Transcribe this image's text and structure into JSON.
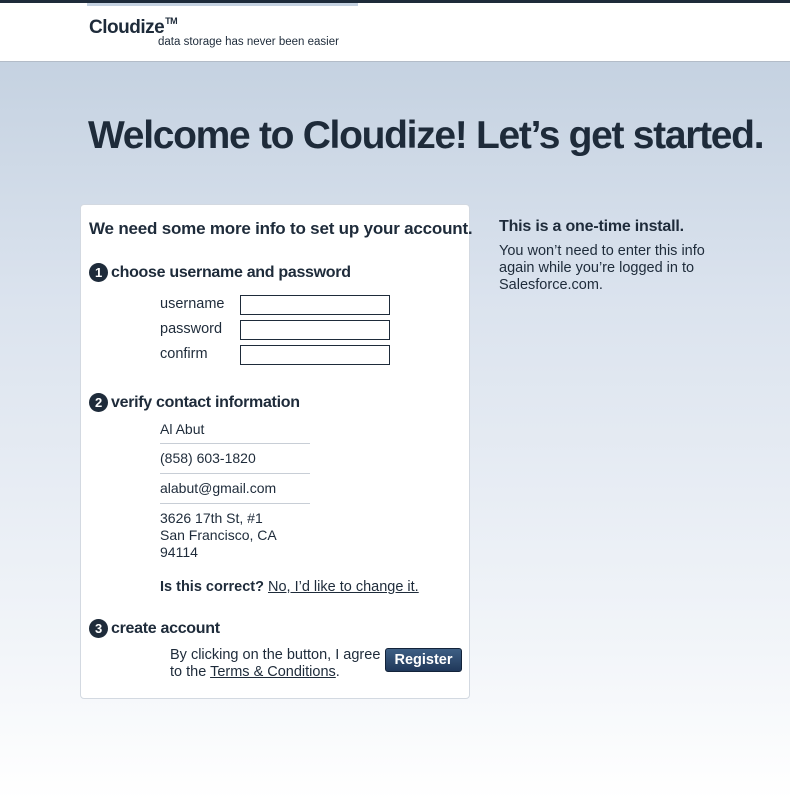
{
  "header": {
    "brand": "Cloudize",
    "trademark": "TM",
    "tagline": "data storage has never been easier"
  },
  "headline": "Welcome to Cloudize! Let’s get started.",
  "form": {
    "title": "We need some more info to set up your account.",
    "step1": {
      "number": "1",
      "title": "choose username and password",
      "fields": [
        {
          "label": "username",
          "value": ""
        },
        {
          "label": "password",
          "value": ""
        },
        {
          "label": "confirm",
          "value": ""
        }
      ]
    },
    "step2": {
      "number": "2",
      "title": "verify contact information",
      "name": "Al Abut",
      "phone": "(858) 603-1820",
      "email": "alabut@gmail.com",
      "address": [
        "3626 17th St, #1",
        "San Francisco, CA",
        "94114"
      ],
      "confirm_question": "Is this correct?",
      "change_link": "No, I’d like to change it."
    },
    "step3": {
      "number": "3",
      "title": "create account",
      "agree_prefix": "By clicking on the button, I agree to the",
      "terms_link": "Terms & Conditions",
      "agree_suffix": ".",
      "register_label": "Register"
    }
  },
  "sidebar": {
    "title": "This is a one-time install.",
    "text": "You won’t need to enter this info again while you’re logged in to Salesforce.com."
  }
}
